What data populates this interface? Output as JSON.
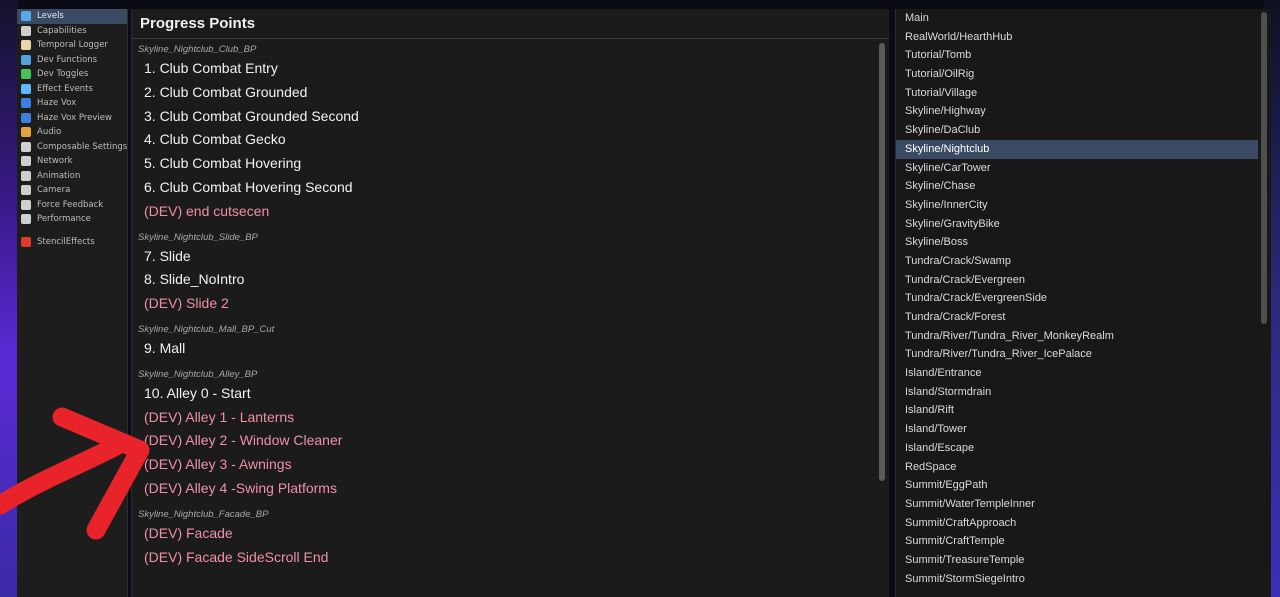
{
  "sidebar": {
    "items": [
      {
        "label": "Levels",
        "icon": "levels-icon",
        "color": "#5aa9e6",
        "selected": true
      },
      {
        "label": "Capabilities",
        "icon": "capabilities-icon",
        "color": "#cfcfcf"
      },
      {
        "label": "Temporal Logger",
        "icon": "hourglass-icon",
        "color": "#e8d6a6"
      },
      {
        "label": "Dev Functions",
        "icon": "functions-icon",
        "color": "#4fa3e0"
      },
      {
        "label": "Dev Toggles",
        "icon": "checkbox-icon",
        "color": "#47c25a"
      },
      {
        "label": "Effect Events",
        "icon": "effect-icon",
        "color": "#5fb7ff"
      },
      {
        "label": "Haze Vox",
        "icon": "haze-icon",
        "color": "#3d7fe0"
      },
      {
        "label": "Haze Vox Preview",
        "icon": "haze-preview-icon",
        "color": "#3d7fe0"
      },
      {
        "label": "Audio",
        "icon": "audio-icon",
        "color": "#e6a23c"
      },
      {
        "label": "Composable Settings",
        "icon": "gear-icon",
        "color": "#d0d0d0"
      },
      {
        "label": "Network",
        "icon": "network-icon",
        "color": "#cfcfcf"
      },
      {
        "label": "Animation",
        "icon": "animation-icon",
        "color": "#cfcfcf"
      },
      {
        "label": "Camera",
        "icon": "camera-icon",
        "color": "#cfcfcf"
      },
      {
        "label": "Force Feedback",
        "icon": "force-feedback-icon",
        "color": "#cfcfcf"
      },
      {
        "label": "Performance",
        "icon": "performance-icon",
        "color": "#cfcfcf"
      }
    ],
    "extra": {
      "label": "StencilEffects",
      "icon": "stencil-effects-icon",
      "color": "#e03a2a"
    }
  },
  "progress": {
    "title": "Progress Points",
    "groups": [
      {
        "label": "Skyline_Nightclub_Club_BP",
        "items": [
          {
            "text": "1. Club Combat Entry",
            "dev": false
          },
          {
            "text": "2. Club Combat Grounded",
            "dev": false
          },
          {
            "text": "3. Club Combat Grounded Second",
            "dev": false
          },
          {
            "text": "4. Club Combat Gecko",
            "dev": false
          },
          {
            "text": "5. Club Combat Hovering",
            "dev": false
          },
          {
            "text": "6. Club Combat Hovering Second",
            "dev": false
          },
          {
            "text": "(DEV) end cutsecen",
            "dev": true
          }
        ]
      },
      {
        "label": "Skyline_Nightclub_Slide_BP",
        "items": [
          {
            "text": "7. Slide",
            "dev": false
          },
          {
            "text": "8. Slide_NoIntro",
            "dev": false
          },
          {
            "text": "(DEV) Slide 2",
            "dev": true
          }
        ]
      },
      {
        "label": "Skyline_Nightclub_Mall_BP_Cut",
        "items": [
          {
            "text": "9. Mall",
            "dev": false
          }
        ]
      },
      {
        "label": "Skyline_Nightclub_Alley_BP",
        "items": [
          {
            "text": "10. Alley 0 - Start",
            "dev": false
          },
          {
            "text": "(DEV) Alley 1 - Lanterns",
            "dev": true
          },
          {
            "text": "(DEV) Alley 2 - Window Cleaner",
            "dev": true
          },
          {
            "text": "(DEV) Alley 3 - Awnings",
            "dev": true
          },
          {
            "text": "(DEV) Alley 4 -Swing Platforms",
            "dev": true
          }
        ]
      },
      {
        "label": "Skyline_Nightclub_Facade_BP",
        "items": [
          {
            "text": "(DEV) Facade",
            "dev": true
          },
          {
            "text": "(DEV) Facade SideScroll End",
            "dev": true
          }
        ]
      }
    ]
  },
  "levels": {
    "selected": "Skyline/Nightclub",
    "items": [
      "Main",
      "RealWorld/HearthHub",
      "Tutorial/Tomb",
      "Tutorial/OilRig",
      "Tutorial/Village",
      "Skyline/Highway",
      "Skyline/DaClub",
      "Skyline/Nightclub",
      "Skyline/CarTower",
      "Skyline/Chase",
      "Skyline/InnerCity",
      "Skyline/GravityBike",
      "Skyline/Boss",
      "Tundra/Crack/Swamp",
      "Tundra/Crack/Evergreen",
      "Tundra/Crack/EvergreenSide",
      "Tundra/Crack/Forest",
      "Tundra/River/Tundra_River_MonkeyRealm",
      "Tundra/River/Tundra_River_IcePalace",
      "Island/Entrance",
      "Island/Stormdrain",
      "Island/Rift",
      "Island/Tower",
      "Island/Escape",
      "RedSpace",
      "Summit/EggPath",
      "Summit/WaterTempleInner",
      "Summit/CraftApproach",
      "Summit/CraftTemple",
      "Summit/TreasureTemple",
      "Summit/StormSiegeIntro"
    ]
  },
  "colors": {
    "dev_text": "#f08fa8",
    "selection": "#3b4a63",
    "annotation_arrow": "#e8232a"
  }
}
